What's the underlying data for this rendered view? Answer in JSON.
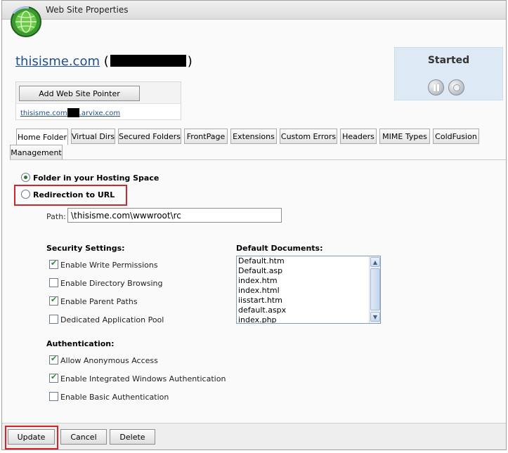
{
  "window": {
    "title": "Web Site Properties"
  },
  "site": {
    "name": "thisisme.com",
    "paren_open": "(",
    "paren_close": ")"
  },
  "status": {
    "label": "Started"
  },
  "pointer": {
    "add_button": "Add Web Site Pointer",
    "link_prefix": "thisisme.com",
    "link_suffix": ".arvixe.com"
  },
  "tabs": [
    {
      "label": "Home Folder"
    },
    {
      "label": "Virtual Dirs"
    },
    {
      "label": "Secured Folders"
    },
    {
      "label": "FrontPage"
    },
    {
      "label": "Extensions"
    },
    {
      "label": "Custom Errors"
    },
    {
      "label": "Headers"
    },
    {
      "label": "MIME Types"
    },
    {
      "label": "ColdFusion"
    },
    {
      "label": "Management"
    }
  ],
  "home_folder": {
    "option_folder": "Folder in your Hosting Space",
    "option_redirect": "Redirection to URL",
    "path_label": "Path:",
    "path_value": "\\thisisme.com\\wwwroot\\rc"
  },
  "security": {
    "heading": "Security Settings:",
    "items": [
      {
        "label": "Enable Write Permissions",
        "checked": true
      },
      {
        "label": "Enable Directory Browsing",
        "checked": false
      },
      {
        "label": "Enable Parent Paths",
        "checked": true
      },
      {
        "label": "Dedicated Application Pool",
        "checked": false
      }
    ]
  },
  "authentication": {
    "heading": "Authentication:",
    "items": [
      {
        "label": "Allow Anonymous Access",
        "checked": true
      },
      {
        "label": "Enable Integrated Windows Authentication",
        "checked": true
      },
      {
        "label": "Enable Basic Authentication",
        "checked": false
      }
    ]
  },
  "default_documents": {
    "heading": "Default Documents:",
    "items": [
      "Default.htm",
      "Default.asp",
      "index.htm",
      "index.html",
      "iisstart.htm",
      "default.aspx",
      "index.php"
    ]
  },
  "footer": {
    "update": "Update",
    "cancel": "Cancel",
    "delete": "Delete"
  },
  "colors": {
    "highlight_red": "#d0252a",
    "link_blue": "#1f4e8a",
    "status_bg": "#dde9f5"
  },
  "icons": {
    "app": "globe-icon",
    "pause": "pause-icon",
    "stop": "stop-icon"
  }
}
